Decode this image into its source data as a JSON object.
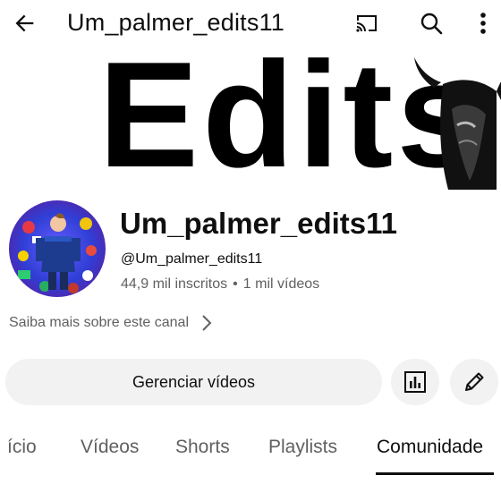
{
  "topbar": {
    "title": "Um_palmer_edits11",
    "icons": [
      "back-arrow-icon",
      "cast-icon",
      "search-icon",
      "more-vert-icon"
    ]
  },
  "banner": {
    "text": "Edits"
  },
  "channel": {
    "name": "Um_palmer_edits11",
    "handle": "@Um_palmer_edits11",
    "subscribers": "44,9 mil inscritos",
    "separator": "•",
    "videos": "1 mil vídeos",
    "more_about": "Saiba mais sobre este canal"
  },
  "actions": {
    "manage_videos": "Gerenciar vídeos"
  },
  "tabs": [
    {
      "label": "ício",
      "active": false
    },
    {
      "label": "Vídeos",
      "active": false
    },
    {
      "label": "Shorts",
      "active": false
    },
    {
      "label": "Playlists",
      "active": false
    },
    {
      "label": "Comunidade",
      "active": true
    }
  ],
  "colors": {
    "text_primary": "#0f0f0f",
    "text_secondary": "#606060",
    "button_bg": "#f2f2f2",
    "background": "#ffffff"
  }
}
